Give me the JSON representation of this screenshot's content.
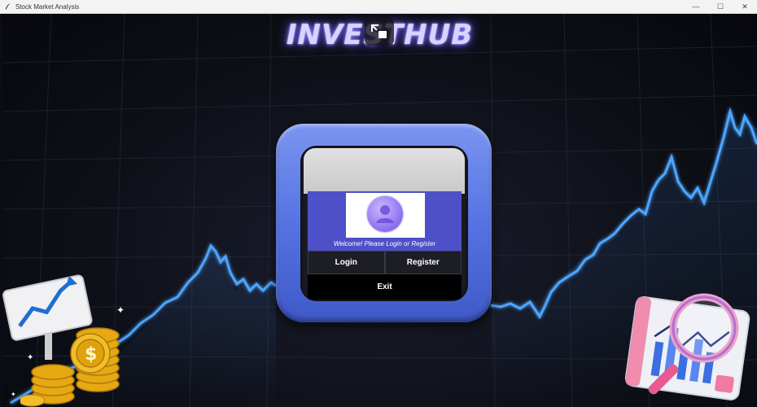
{
  "window": {
    "title": "Stock Market Analysis"
  },
  "window_controls": {
    "minimize": "—",
    "maximize": "☐",
    "close": "✕"
  },
  "brand": {
    "name": "INVESTHUB"
  },
  "login_panel": {
    "welcome_text": "Welcome! Please Login or Register",
    "login_label": "Login",
    "register_label": "Register",
    "exit_label": "Exit"
  },
  "colors": {
    "frame": "#5a76e6",
    "band": "#4e50c7",
    "chart_line": "#4da6ff",
    "brand_glow": "#8f7dff"
  }
}
